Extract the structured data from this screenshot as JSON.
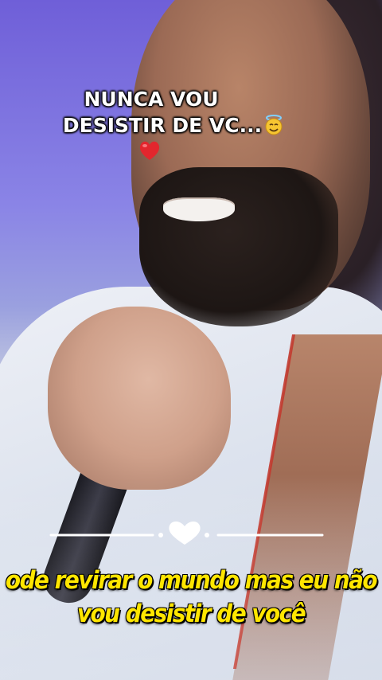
{
  "overlay_caption": {
    "line1": "NUNCA VOU",
    "line2": "DESISTIR DE VC...",
    "emoji_after_line2": "smiling-face-with-halo-icon",
    "emoji_below": "red-heart-icon"
  },
  "divider": {
    "icon": "heart-icon"
  },
  "lyrics": {
    "line1": "ode revirar o mundo mas eu não",
    "line2": "vou desistir de você"
  },
  "colors": {
    "caption_text": "#ffffff",
    "lyrics_text": "#ffe600",
    "heart_red": "#e3262d",
    "halo_face_yellow": "#f6c531"
  }
}
